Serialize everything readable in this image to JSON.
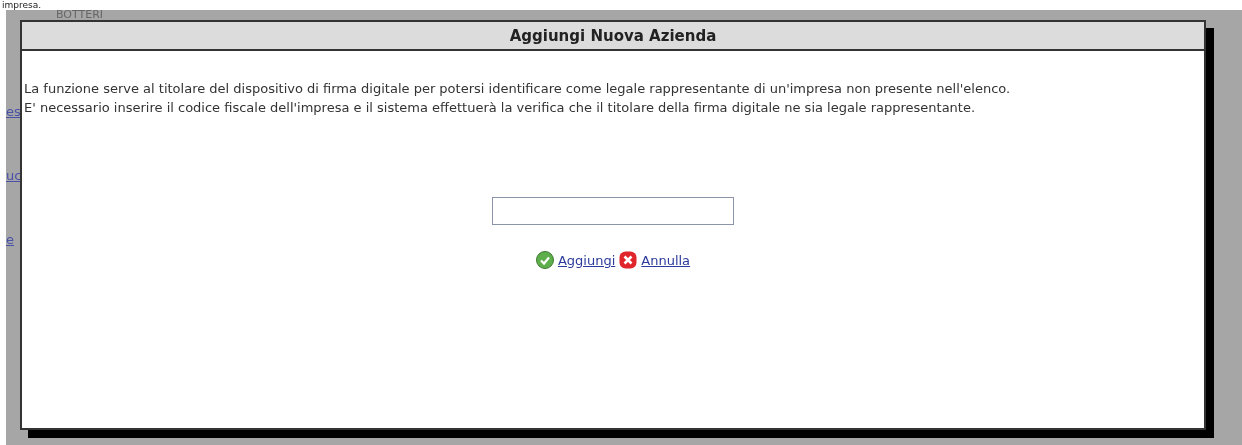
{
  "page_top_text": "impresa.",
  "background": {
    "heading": "BOTTERI",
    "link_fragments": [
      "es",
      "uc",
      "e"
    ]
  },
  "dialog": {
    "title": "Aggiungi Nuova Azienda",
    "paragraphs": [
      "La funzione serve al titolare del dispositivo di firma digitale per potersi identificare come legale rappresentante di un'impresa non presente nell'elenco.",
      "E' necessario inserire il codice fiscale dell'impresa e il sistema effettuerà la verifica che il titolare della firma digitale ne sia legale rappresentante."
    ],
    "actions": [
      {
        "kind": "confirm",
        "label": "Aggiungi"
      },
      {
        "kind": "cancel",
        "label": "Annulla"
      }
    ]
  }
}
